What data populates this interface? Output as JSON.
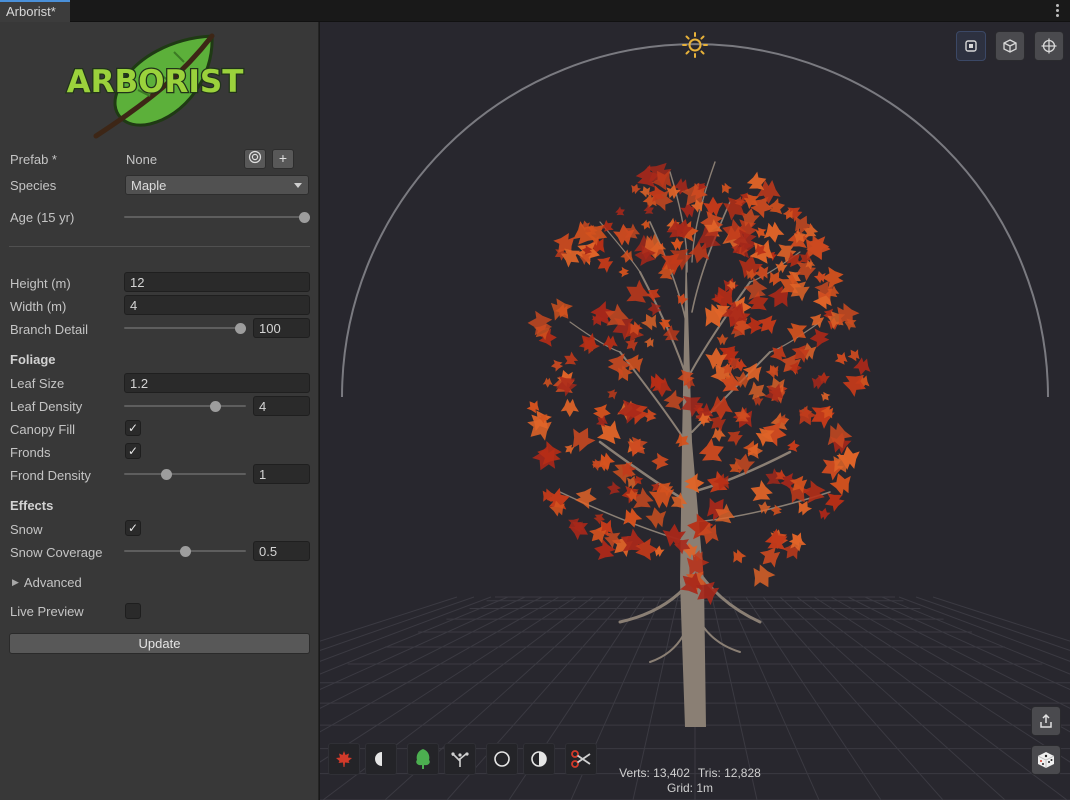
{
  "window": {
    "tab_title": "Arborist*"
  },
  "logo": {
    "text": "ARBORIST"
  },
  "inspector": {
    "prefab": {
      "label": "Prefab *",
      "value": "None"
    },
    "species": {
      "label": "Species",
      "value": "Maple"
    },
    "age": {
      "label": "Age (15 yr)",
      "fraction": 1.0
    },
    "height": {
      "label": "Height (m)",
      "value": "12"
    },
    "width": {
      "label": "Width (m)",
      "value": "4"
    },
    "branch_detail": {
      "label": "Branch Detail",
      "value": "100",
      "fraction": 1.0
    },
    "foliage": {
      "heading": "Foliage",
      "leaf_size": {
        "label": "Leaf Size",
        "value": "1.2"
      },
      "leaf_density": {
        "label": "Leaf Density",
        "value": "4",
        "fraction": 0.77
      },
      "canopy_fill": {
        "label": "Canopy Fill",
        "checked": true
      },
      "fronds": {
        "label": "Fronds",
        "checked": true
      },
      "frond_density": {
        "label": "Frond Density",
        "value": "1",
        "fraction": 0.33
      }
    },
    "effects": {
      "heading": "Effects",
      "snow": {
        "label": "Snow",
        "checked": true
      },
      "snow_coverage": {
        "label": "Snow Coverage",
        "value": "0.5",
        "fraction": 0.5
      }
    },
    "advanced": {
      "label": "Advanced"
    },
    "live_preview": {
      "label": "Live Preview",
      "checked": false
    },
    "update_button": "Update",
    "check_glyph": "✓",
    "foldout_glyph": "▶",
    "plus_glyph": "+"
  },
  "viewport": {
    "stats": {
      "verts": "Verts: 13,402",
      "tris": "Tris: 12,828",
      "grid": "Grid: 1m"
    },
    "colors": {
      "background": "#28272e",
      "sun": "#e8b23a",
      "leaf": "#c8401c",
      "trunk": "#8a7f74"
    },
    "top_buttons": [
      "frame-icon",
      "cube-icon",
      "crosshair-icon"
    ],
    "tools": [
      "maple-leaf-icon",
      "half-moon-icon",
      "tree-icon",
      "branch-icon",
      "circle-icon",
      "half-circle-icon",
      "scissors-icon"
    ],
    "side_buttons": [
      "export-icon",
      "dice-icon"
    ]
  }
}
